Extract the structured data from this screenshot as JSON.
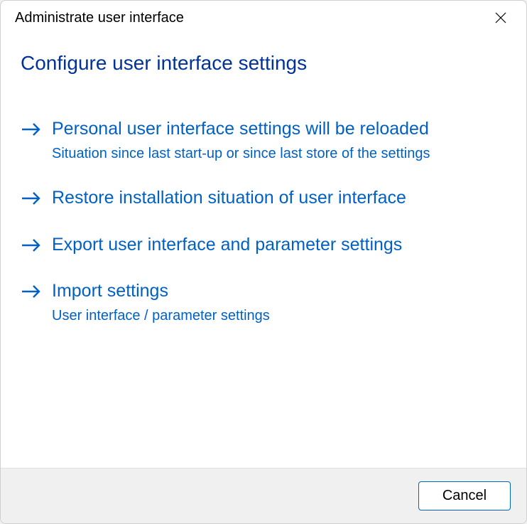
{
  "titlebar": {
    "title": "Administrate user interface"
  },
  "heading": "Configure user interface settings",
  "options": [
    {
      "title": "Personal user interface settings will be reloaded",
      "desc": "Situation since last start-up or since last store of the settings"
    },
    {
      "title": "Restore installation situation of user interface",
      "desc": ""
    },
    {
      "title": "Export user interface and parameter settings",
      "desc": ""
    },
    {
      "title": "Import settings",
      "desc": "User interface / parameter settings"
    }
  ],
  "footer": {
    "cancel_label": "Cancel"
  },
  "colors": {
    "heading": "#003399",
    "link": "#0061c3",
    "border_accent": "#0067c0"
  }
}
